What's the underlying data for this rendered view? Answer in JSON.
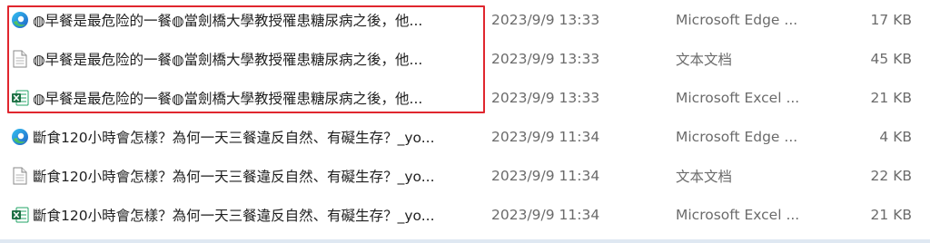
{
  "files": [
    {
      "icon": "edge-icon",
      "name": "◍早餐是最危险的一餐◍當劍橋大學教授罹患糖尿病之後，他...",
      "date": "2023/9/9 13:33",
      "type": "Microsoft Edge ...",
      "size": "17 KB"
    },
    {
      "icon": "text-document-icon",
      "name": "◍早餐是最危险的一餐◍當劍橋大學教授罹患糖尿病之後，他...",
      "date": "2023/9/9 13:33",
      "type": "文本文档",
      "size": "45 KB"
    },
    {
      "icon": "excel-icon",
      "name": "◍早餐是最危险的一餐◍當劍橋大學教授罹患糖尿病之後，他...",
      "date": "2023/9/9 13:33",
      "type": "Microsoft Excel ...",
      "size": "21 KB"
    },
    {
      "icon": "edge-icon",
      "name": "斷食120小時會怎樣？為何一天三餐違反自然、有礙生存？_yo...",
      "date": "2023/9/9 11:34",
      "type": "Microsoft Edge ...",
      "size": "4 KB"
    },
    {
      "icon": "text-document-icon",
      "name": "斷食120小時會怎樣？為何一天三餐違反自然、有礙生存？_yo...",
      "date": "2023/9/9 11:34",
      "type": "文本文档",
      "size": "22 KB"
    },
    {
      "icon": "excel-icon",
      "name": "斷食120小時會怎樣？為何一天三餐違反自然、有礙生存？_yo...",
      "date": "2023/9/9 11:34",
      "type": "Microsoft Excel ...",
      "size": "21 KB"
    }
  ],
  "colors": {
    "highlight": "#e0262e",
    "edge_blue": "#1e7fd6",
    "edge_green": "#2fb16e",
    "excel_green": "#1d7044"
  }
}
